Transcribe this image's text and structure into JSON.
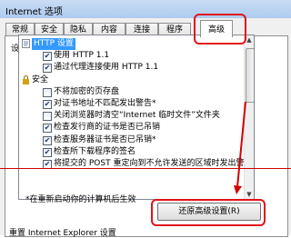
{
  "window": {
    "title": "Internet 选项"
  },
  "tabs": [
    "常规",
    "安全",
    "隐私",
    "内容",
    "连接",
    "程序",
    "高级"
  ],
  "settings": {
    "section_label": "设置",
    "items": [
      {
        "kind": "group",
        "icon": "globe",
        "label": "HTTP 设置",
        "selected": true
      },
      {
        "kind": "check",
        "checked": true,
        "label": "使用 HTTP 1.1"
      },
      {
        "kind": "check",
        "checked": true,
        "label": "通过代理连接使用 HTTP 1.1"
      },
      {
        "kind": "group",
        "icon": "lock",
        "label": "安全"
      },
      {
        "kind": "check",
        "checked": false,
        "label": "不将加密的页存盘"
      },
      {
        "kind": "check",
        "checked": true,
        "label": "对证书地址不匹配发出警告*"
      },
      {
        "kind": "check",
        "checked": false,
        "label": "关闭浏览器时清空“Internet 临时文件”文件夹"
      },
      {
        "kind": "check",
        "checked": true,
        "label": "检查发行商的证书是否已吊销"
      },
      {
        "kind": "check",
        "checked": true,
        "label": "检查服务器证书是否已吊销*"
      },
      {
        "kind": "check",
        "checked": true,
        "label": "检查所下载程序的签名"
      },
      {
        "kind": "check",
        "checked": true,
        "label": "将提交的 POST 重定向到不允许发送的区域时发出警告"
      }
    ]
  },
  "restart_note": "*在重新启动你的计算机后生效",
  "restore_button": "还原高级设置(R)",
  "reset_section_label": "重置 Internet Explorer 设置"
}
